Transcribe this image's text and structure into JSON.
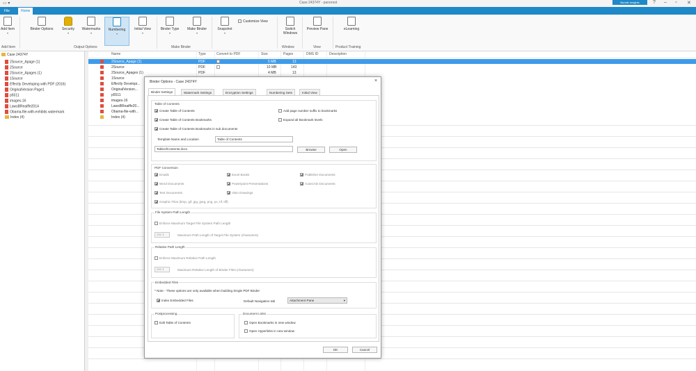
{
  "window": {
    "title": "Case 24374Y - panoroot",
    "brand_button": "Bundle Insights"
  },
  "menu": {
    "tabs": [
      "File",
      "Home"
    ]
  },
  "ribbon": {
    "buttons": [
      {
        "label": "Add Item",
        "icon": "add-item-icon"
      },
      {
        "label": "Binder Options",
        "icon": "binder-options-icon"
      },
      {
        "label": "Security",
        "icon": "lock-icon"
      },
      {
        "label": "Watermarks",
        "icon": "watermarks-icon"
      },
      {
        "label": "Numbering",
        "icon": "numbering-icon"
      },
      {
        "label": "Initial View",
        "icon": "initial-view-icon"
      },
      {
        "label": "Binder Type",
        "icon": "binder-type-icon"
      },
      {
        "label": "Make Binder",
        "icon": "make-binder-icon"
      },
      {
        "label": "Snapshot",
        "icon": "snapshot-icon"
      },
      {
        "label": "Switch Windows",
        "icon": "switch-windows-icon"
      },
      {
        "label": "Preview Pane",
        "icon": "preview-pane-icon"
      },
      {
        "label": "eLearning",
        "icon": "elearning-icon"
      }
    ],
    "customize_view": "Customize View",
    "groups": [
      "Add Item",
      "Output Options",
      "Make Binder",
      "Window",
      "View",
      "Product Training"
    ]
  },
  "tree": {
    "root": "Case 24374Y",
    "items": [
      "2Source_Apage (1)",
      "2Source",
      "2Source_Apages (1)",
      "1Source",
      "Effectly Developing with PDF (2016)",
      "OriginalVersion Page1",
      "p5511",
      "images-16",
      "LawsBReaiffe2014",
      "Obama-file-with-exhibits watermark"
    ],
    "folder": "Index (4)"
  },
  "grid": {
    "columns": [
      "Name",
      "Type",
      "Convert to PDF",
      "Size",
      "Pages",
      "DMS ID",
      "Description"
    ],
    "rows": [
      {
        "name": "2Source_Apage (1)",
        "type": "PDF",
        "size": "5 MB",
        "pages": "13",
        "selected": true
      },
      {
        "name": "2Source",
        "type": "PDF",
        "size": "10 MB",
        "pages": "143"
      },
      {
        "name": "2Source_Apages (1)",
        "type": "PDF",
        "size": "4 MB",
        "pages": "13"
      },
      {
        "name": "1Source",
        "type": "",
        "size": "",
        "pages": ""
      },
      {
        "name": "Effectly Developi...",
        "type": "",
        "size": "",
        "pages": ""
      },
      {
        "name": "OriginalVersion...",
        "type": "",
        "size": "",
        "pages": ""
      },
      {
        "name": "p5511",
        "type": "",
        "size": "",
        "pages": ""
      },
      {
        "name": "images-16",
        "type": "",
        "size": "",
        "pages": ""
      },
      {
        "name": "LawsBReaiffe20...",
        "type": "",
        "size": "",
        "pages": ""
      },
      {
        "name": "Obama-file-with...",
        "type": "",
        "size": "",
        "pages": ""
      },
      {
        "name": "Index (4)",
        "type": "",
        "size": "",
        "pages": ""
      }
    ]
  },
  "dialog": {
    "title": "Binder Options - Case 24374Y",
    "tabs": [
      "Binder Settings",
      "Watermark Settings",
      "Encryption Settings",
      "Numbering Sets",
      "Initial View"
    ],
    "toc": {
      "title": "Table of Contents",
      "create_toc": "Create Table of Contents",
      "create_bookmarks": "Create Table of Contents Bookmarks",
      "create_sub_bookmarks": "Create Table of Contents Bookmarks in sub documents",
      "add_page_suffix": "Add page number suffix to bookmarks",
      "expand_all": "Expand all Bookmark levels",
      "template_label": "Template Name and Location",
      "template_name": "Table of Contents",
      "template_path": "TableofContents.docx",
      "browse": "Browse",
      "open": "Open"
    },
    "conversion": {
      "title": "PDF Conversion",
      "emails": "Emails",
      "excel": "Excel Books",
      "publisher": "Publisher Documents",
      "word": "Word Documents",
      "powerpoint": "Powerpoint Presentations",
      "autocad": "AutoCAD Documents",
      "text": "Text Documents",
      "visio": "Visio Drawings",
      "graphic": "Graphic Files (bmp, gif, jpg, jpeg, png, pc, tif, tiff)"
    },
    "fs_path": {
      "title": "File System Path Length",
      "enforce": "Enforce Maximum Target File System Path Length",
      "spin": "255",
      "max_label": "Maximum Path Length of Target File System (characters)"
    },
    "rel_path": {
      "title": "Relative Path Length",
      "enforce": "Enforce Maximum Relative Path Length",
      "spin": "255",
      "max_label": "Maximum Relative Length of Binder Files (characters)"
    },
    "embedded": {
      "title": "Embedded Files",
      "note": "* Note - These options are only available when building Single PDF Binder",
      "index": "Index Embedded Files",
      "nav_label": "Default Navigation tab",
      "nav_value": "Attachment Pane"
    },
    "postproc": {
      "title": "Postprocessing",
      "edit_toc": "Edit Table of Contents"
    },
    "doclinks": {
      "title": "Document Links",
      "open_bookmarks": "Open Bookmarks in new window",
      "open_hyperlinks": "Open Hyperlinks in new window"
    },
    "ok": "OK",
    "cancel": "Cancel"
  }
}
